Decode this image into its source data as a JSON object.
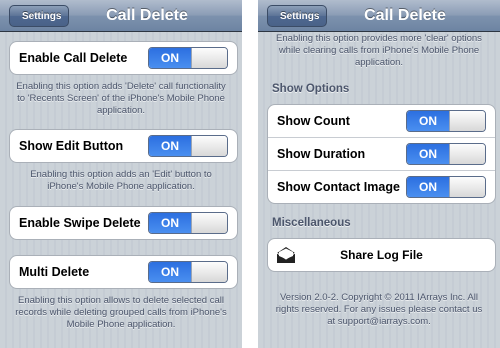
{
  "left": {
    "navbar": {
      "back_label": "Settings",
      "title": "Call Delete"
    },
    "rows": {
      "enable_call_delete": {
        "label": "Enable Call Delete",
        "switch": "ON"
      },
      "show_edit_button": {
        "label": "Show Edit Button",
        "switch": "ON"
      },
      "enable_swipe_delete": {
        "label": "Enable Swipe Delete",
        "switch": "ON"
      },
      "multi_delete": {
        "label": "Multi Delete",
        "switch": "ON"
      }
    },
    "notes": {
      "call_delete": "Enabling this option adds 'Delete' call functionality to 'Recents Screen' of the iPhone's Mobile Phone application.",
      "edit_button": "Enabling this option adds an 'Edit' button to iPhone's Mobile Phone application.",
      "multi_delete": "Enabling this option allows to delete selected call records while deleting grouped calls from iPhone's Mobile Phone application."
    }
  },
  "right": {
    "navbar": {
      "back_label": "Settings",
      "title": "Call Delete"
    },
    "top_note": "Enabling this option provides more 'clear' options while clearing calls from iPhone's Mobile Phone application.",
    "show_options": {
      "header": "Show Options",
      "rows": {
        "count": {
          "label": "Show Count",
          "switch": "ON"
        },
        "duration": {
          "label": "Show Duration",
          "switch": "ON"
        },
        "contact_image": {
          "label": "Show Contact Image",
          "switch": "ON"
        }
      }
    },
    "misc": {
      "header": "Miscellaneous",
      "share_label": "Share Log File"
    },
    "footer": "Version 2.0-2. Copyright © 2011 IArrays Inc. All rights reserved. For any issues please contact us at support@iarrays.com."
  },
  "colors": {
    "switch_on": "#2c6fe0",
    "navbar": "#7d92ae",
    "background": "#c5ccd4"
  },
  "icons": {
    "share": "envelope-icon"
  }
}
